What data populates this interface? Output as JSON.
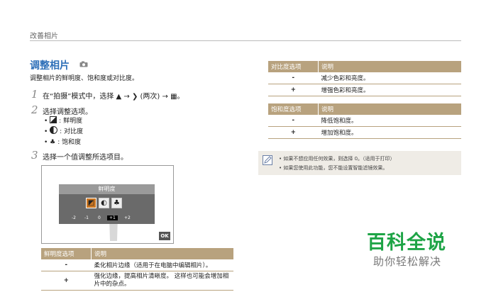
{
  "header": {
    "title": "改善相片"
  },
  "section": {
    "title": "调整相片",
    "camera_icon": "camera-icon",
    "intro": "调整相片的鲜明度、饱和度或对比度。"
  },
  "steps": [
    {
      "num": "1",
      "text": "在“拍摄”模式中，选择 ▲ → ❯ (两次) → ▦。"
    },
    {
      "num": "2",
      "text": "选择调整选项。",
      "bullets": [
        {
          "icon": "sharpness-icon",
          "label": "鲜明度"
        },
        {
          "icon": "contrast-icon",
          "label": "对比度"
        },
        {
          "icon": "saturation-icon",
          "label": "饱和度"
        }
      ]
    },
    {
      "num": "3",
      "text": "选择一个值调整所选项目。"
    }
  ],
  "preview": {
    "bar_label": "鲜明度",
    "scale": [
      "-2",
      "-1",
      "0",
      "+1",
      "+2"
    ],
    "selected": "+1",
    "ok": "OK"
  },
  "tables": {
    "sharpness": {
      "headers": [
        "鲜明度选项",
        "说明"
      ],
      "rows": [
        {
          "sym": "-",
          "desc": "柔化相片边缘（适用于在电脑中编辑相片）。"
        },
        {
          "sym": "+",
          "desc": "强化边缘，提高相片清晰度。 这样也可能会增加相片中的杂点。"
        }
      ]
    },
    "contrast": {
      "headers": [
        "对比度选项",
        "说明"
      ],
      "rows": [
        {
          "sym": "-",
          "desc": "减少色彩和亮度。"
        },
        {
          "sym": "+",
          "desc": "增强色彩和亮度。"
        }
      ]
    },
    "saturation": {
      "headers": [
        "饱和度选项",
        "说明"
      ],
      "rows": [
        {
          "sym": "-",
          "desc": "降低饱和度。"
        },
        {
          "sym": "+",
          "desc": "增加饱和度。"
        }
      ]
    }
  },
  "notes": {
    "icon": "note-icon",
    "items": [
      "如果不想应用任何效果，则选择 0。（适用于打印）",
      "如果您使用此功能，您不能设置智能滤镜效果。"
    ]
  },
  "watermark": {
    "title": "百科全说",
    "subtitle": "助你轻松解决"
  },
  "colors": {
    "title_blue": "#2d6fb8",
    "table_header": "#b8a27e",
    "logo_green": "#1ea446"
  }
}
